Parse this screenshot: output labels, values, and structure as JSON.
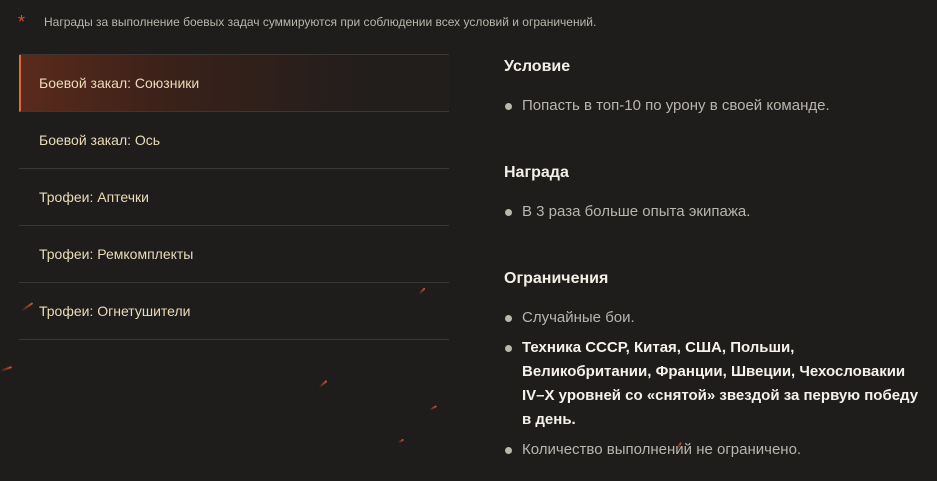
{
  "note": {
    "marker": "*",
    "text": "Награды за выполнение боевых задач суммируются при соблюдении всех условий и ограничений."
  },
  "menu": {
    "items": [
      {
        "label": "Боевой закал: Союзники",
        "active": true
      },
      {
        "label": "Боевой закал: Ось",
        "active": false
      },
      {
        "label": "Трофеи: Аптечки",
        "active": false
      },
      {
        "label": "Трофеи: Ремкомплекты",
        "active": false
      },
      {
        "label": "Трофеи: Огнетушители",
        "active": false
      }
    ]
  },
  "details": {
    "condition": {
      "title": "Условие",
      "items": [
        "Попасть в топ-10 по урону в своей команде."
      ]
    },
    "reward": {
      "title": "Награда",
      "items": [
        "В 3 раза больше опыта экипажа."
      ]
    },
    "restrictions": {
      "title": "Ограничения",
      "items": [
        "Случайные бои.",
        "Техника СССР, Китая, США, Польши, Великобритании, Франции, Швеции, Чехословакии IV–X уровней со «снятой» звездой за первую победу в день.",
        "Количество выполнений не ограничено."
      ]
    }
  },
  "colors": {
    "background": "#1e1d1c",
    "accent": "#e06a3a",
    "menu_text": "#e9dcb7",
    "body_text": "#b9b5ad"
  }
}
